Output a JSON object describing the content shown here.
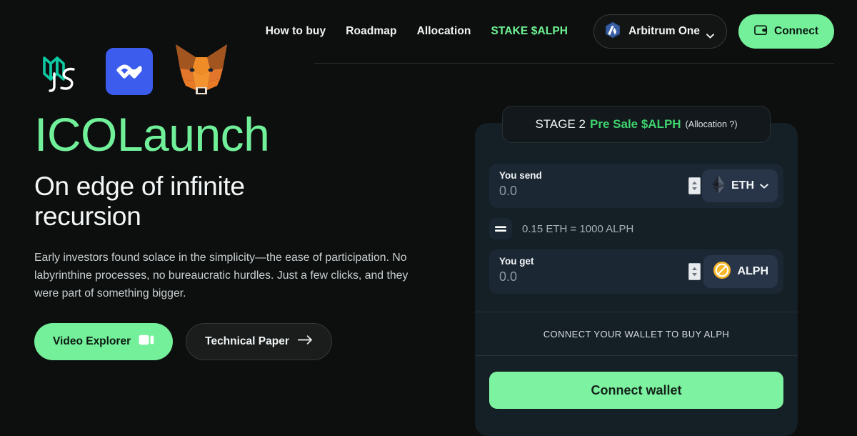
{
  "header": {
    "nav": [
      {
        "label": "How to buy",
        "accent": false
      },
      {
        "label": "Roadmap",
        "accent": false
      },
      {
        "label": "Allocation",
        "accent": false
      },
      {
        "label": "STAKE $ALPH",
        "accent": true
      }
    ],
    "chain": {
      "name": "Arbitrum One",
      "icon": "arbitrum-logo-icon",
      "chevron": "chevron-down-icon"
    },
    "connect": {
      "label": "Connect",
      "icon": "wallet-icon"
    }
  },
  "wallet_logos": [
    {
      "name": "web3js-logo-icon"
    },
    {
      "name": "walletconnect-logo-icon"
    },
    {
      "name": "metamask-fox-logo-icon"
    }
  ],
  "hero": {
    "brand": "ICOLaunch",
    "headline": "On edge of infinite recursion",
    "body": "Early investors found solace in the simplicity—the ease of participation. No labyrinthine processes, no bureaucratic hurdles. Just a few clicks, and they were part of something bigger.",
    "primary_cta": {
      "label": "Video Explorer",
      "icon": "video-camera-icon"
    },
    "secondary_cta": {
      "label": "Technical Paper",
      "icon": "arrow-right-icon"
    }
  },
  "swap": {
    "stage": {
      "prefix": "STAGE 2",
      "accent": "Pre Sale $ALPH",
      "note": "(Allocation ?)"
    },
    "send": {
      "label": "You send",
      "value": "0.0",
      "placeholder": "0.0",
      "token": "ETH",
      "token_icon": "ethereum-logo-icon",
      "has_chevron": true
    },
    "rate": {
      "badge_icon": "equals-icon",
      "text": "0.15 ETH = 1000 ALPH"
    },
    "get": {
      "label": "You get",
      "value": "0.0",
      "placeholder": "0.0",
      "token": "ALPH",
      "token_icon": "alph-logo-icon",
      "has_chevron": false
    },
    "notice": "CONNECT YOUR WALLET TO BUY ALPH",
    "action": {
      "label": "Connect wallet"
    }
  },
  "colors": {
    "accent_green": "#74f09a",
    "bright_green": "#71f09a",
    "stage_green": "#3fd46f",
    "page_bg": "#0d0f0e",
    "card_bg": "#151f26",
    "field_bg": "#1c2734",
    "chip_bg": "#283548",
    "walletconnect_blue": "#3b5ced",
    "alph_yellow": "#f5b627"
  }
}
